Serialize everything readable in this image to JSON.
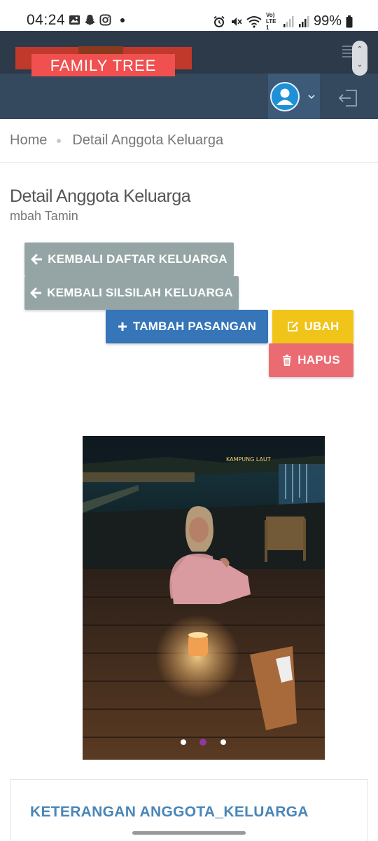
{
  "status_bar": {
    "time": "04:24",
    "battery": "99%",
    "network_label": "Vo) LTE1"
  },
  "header": {
    "logo_text": "FAMILY TREE"
  },
  "breadcrumb": {
    "home": "Home",
    "current": "Detail Anggota Keluarga"
  },
  "page": {
    "title": "Detail Anggota Keluarga",
    "subtitle": "mbah Tamin"
  },
  "buttons": {
    "back_list": "KEMBALI DAFTAR KELUARGA",
    "back_tree": "KEMBALI SILSILAH KELUARGA",
    "add_spouse": "TAMBAH PASANGAN",
    "edit": "UBAH",
    "delete": "HAPUS"
  },
  "photo": {
    "sign_text": "KAMPUNG LAUT",
    "carousel_count": 3,
    "carousel_active": 2
  },
  "info_card": {
    "title": "KETERANGAN ANGGOTA_KELUARGA"
  },
  "colors": {
    "header_dark": "#2d3a4a",
    "header_mid": "#34485e",
    "logo_red": "#f0504f",
    "grey_button": "#95a5a6",
    "blue_button": "#3575b8",
    "yellow_button": "#f0c419",
    "red_button": "#ea6c72",
    "card_title": "#4a86b8"
  }
}
